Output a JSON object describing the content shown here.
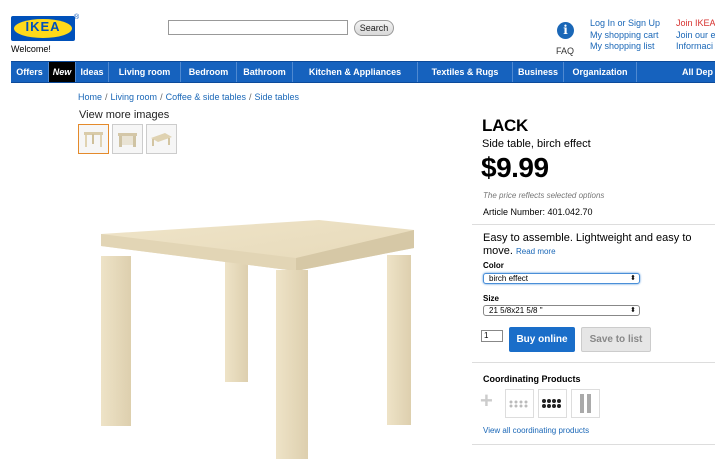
{
  "header": {
    "logo_text": "IKEA",
    "logo_mark": "®",
    "welcome": "Welcome!",
    "search": {
      "value": "",
      "placeholder": "",
      "button": "Search"
    },
    "faq": {
      "icon": "info-icon",
      "label": "FAQ"
    },
    "account_links": [
      "Log In or Sign Up",
      "My shopping cart",
      "My shopping list"
    ],
    "join_links": [
      "Join IKEA",
      "Join our e",
      "Informaci"
    ]
  },
  "nav": {
    "items": [
      {
        "label": "Offers"
      },
      {
        "label": "New"
      },
      {
        "label": "Ideas"
      },
      {
        "label": "Living room"
      },
      {
        "label": "Bedroom"
      },
      {
        "label": "Bathroom"
      },
      {
        "label": "Kitchen & Appliances"
      },
      {
        "label": "Textiles & Rugs"
      },
      {
        "label": "Business"
      },
      {
        "label": "Organization"
      },
      {
        "label": "All Dep"
      }
    ]
  },
  "breadcrumb": [
    "Home",
    "Living room",
    "Coffee & side tables",
    "Side tables"
  ],
  "gallery": {
    "view_more": "View more images"
  },
  "product": {
    "name": "LACK",
    "description": "Side table, birch effect",
    "price": "$9.99",
    "price_note": "The price reflects selected options",
    "article": "Article Number: 401.042.70",
    "summary": "Easy to assemble. Lightweight and easy to move.",
    "read_more": "Read more",
    "color_label": "Color",
    "color_value": "birch effect",
    "size_label": "Size",
    "size_value": "21 5/8x21 5/8 \"",
    "quantity": "1",
    "buy_label": "Buy online",
    "save_label": "Save to list"
  },
  "coordinating": {
    "title": "Coordinating Products",
    "view_all": "View all coordinating products"
  },
  "colors": {
    "brand_blue": "#0051ba",
    "brand_yellow": "#ffda1a",
    "nav_blue": "#1662be",
    "link_blue": "#1a67b7",
    "buy_blue": "#1a6ec9",
    "join_red": "#d6322f"
  }
}
